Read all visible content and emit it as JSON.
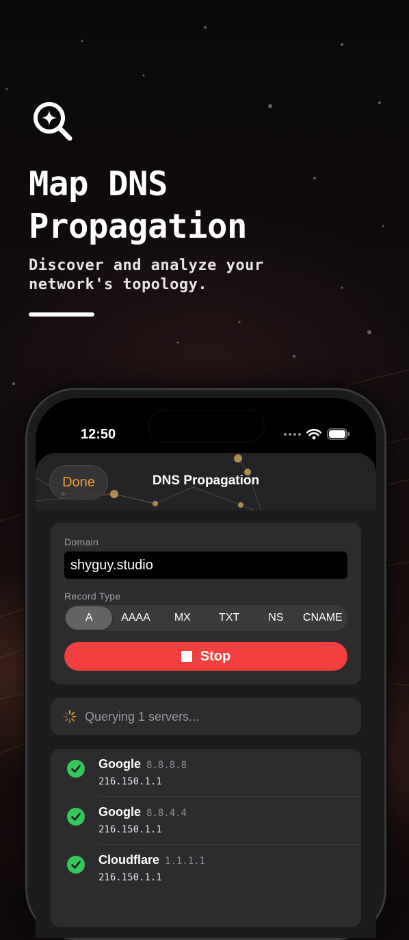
{
  "hero": {
    "icon": "sparkle-magnifier-icon",
    "title_line1": "Map DNS",
    "title_line2": "Propagation",
    "subtitle_line1": "Discover and analyze your",
    "subtitle_line2": "network's topology."
  },
  "status_bar": {
    "time": "12:50",
    "icons": [
      "signal-dots-icon",
      "wifi-icon",
      "battery-icon"
    ]
  },
  "navbar": {
    "done_label": "Done",
    "title": "DNS Propagation"
  },
  "form": {
    "domain_label": "Domain",
    "domain_value": "shyguy.studio",
    "record_type_label": "Record Type",
    "record_types": [
      "A",
      "AAAA",
      "MX",
      "TXT",
      "NS",
      "CNAME"
    ],
    "selected_record_type": "A",
    "stop_label": "Stop"
  },
  "progress": {
    "text": "Querying 1 servers..."
  },
  "results": [
    {
      "name": "Google",
      "server_ip": "8.8.8.8",
      "answer": "216.150.1.1",
      "status": "success"
    },
    {
      "name": "Google",
      "server_ip": "8.8.4.4",
      "answer": "216.150.1.1",
      "status": "success"
    },
    {
      "name": "Cloudflare",
      "server_ip": "1.1.1.1",
      "answer": "216.150.1.1",
      "status": "success"
    }
  ],
  "colors": {
    "accent": "#f29a32",
    "stop": "#f1403f",
    "success": "#34c759",
    "card": "#2c2c2e"
  }
}
